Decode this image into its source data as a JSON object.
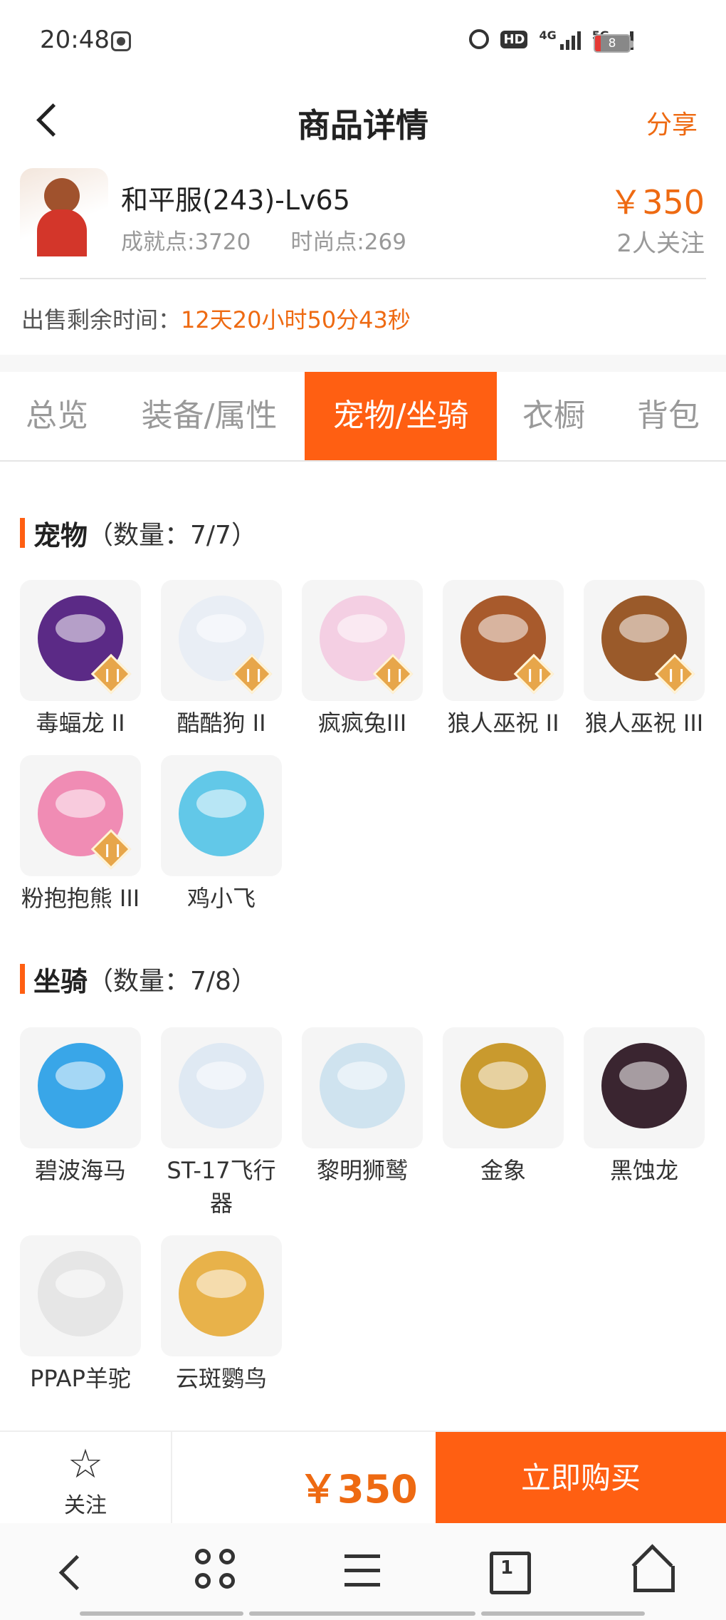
{
  "status_bar": {
    "time": "20:48",
    "hd_label": "HD",
    "net1": "4G",
    "net2": "5G",
    "battery": "8"
  },
  "header": {
    "title": "商品详情",
    "share": "分享"
  },
  "product": {
    "name": "和平服(243)-Lv65",
    "achievement": "成就点:3720",
    "fashion": "时尚点:269",
    "price": "￥350",
    "followers": "2人关注",
    "remaining_label": "出售剩余时间：",
    "remaining_value": "12天20小时50分43秒"
  },
  "tabs": [
    {
      "label": "总览"
    },
    {
      "label": "装备/属性"
    },
    {
      "label": "宠物/坐骑",
      "active": true
    },
    {
      "label": "衣橱"
    },
    {
      "label": "背包"
    }
  ],
  "pets": {
    "title": "宠物",
    "count": "（数量：7/7）",
    "items": [
      {
        "name": "毒蝠龙 II",
        "icon": "purple-dragon-icon",
        "color": "#5b2a86",
        "rank": true
      },
      {
        "name": "酷酷狗 II",
        "icon": "white-dog-icon",
        "color": "#e9eef5",
        "rank": true
      },
      {
        "name": "疯疯兔III",
        "icon": "pink-rabbit-icon",
        "color": "#f4cfe3",
        "rank": true
      },
      {
        "name": "狼人巫祝 II",
        "icon": "werewolf-icon",
        "color": "#a85a2c",
        "rank": true
      },
      {
        "name": "狼人巫祝 III",
        "icon": "werewolf-icon",
        "color": "#9a5a2a",
        "rank": true
      },
      {
        "name": "粉抱抱熊 III",
        "icon": "pink-bear-icon",
        "color": "#f08cb4",
        "rank": true
      },
      {
        "name": "鸡小飞",
        "icon": "blue-chick-icon",
        "color": "#62c8e8",
        "rank": false
      }
    ]
  },
  "mounts": {
    "title": "坐骑",
    "count": "（数量：7/8）",
    "items": [
      {
        "name": "碧波海马",
        "icon": "seahorse-icon",
        "color": "#39a6e8"
      },
      {
        "name": "ST-17飞行器",
        "icon": "aircraft-icon",
        "color": "#dfe9f3"
      },
      {
        "name": "黎明狮鹫",
        "icon": "griffin-icon",
        "color": "#cfe3ef"
      },
      {
        "name": "金象",
        "icon": "gold-elephant-icon",
        "color": "#c99a2e"
      },
      {
        "name": "黑蚀龙",
        "icon": "black-dragon-icon",
        "color": "#3a2530"
      },
      {
        "name": "PPAP羊驼",
        "icon": "alpaca-icon",
        "color": "#e6e6e6"
      },
      {
        "name": "云斑鹦鸟",
        "icon": "parrot-icon",
        "color": "#e8b24a"
      }
    ]
  },
  "bottom": {
    "follow": "关注",
    "price": "￥350",
    "buy": "立即购买"
  },
  "nav": {
    "tabs_count": "1"
  },
  "colors": {
    "accent": "#ff5f12",
    "price": "#ee6a12"
  }
}
